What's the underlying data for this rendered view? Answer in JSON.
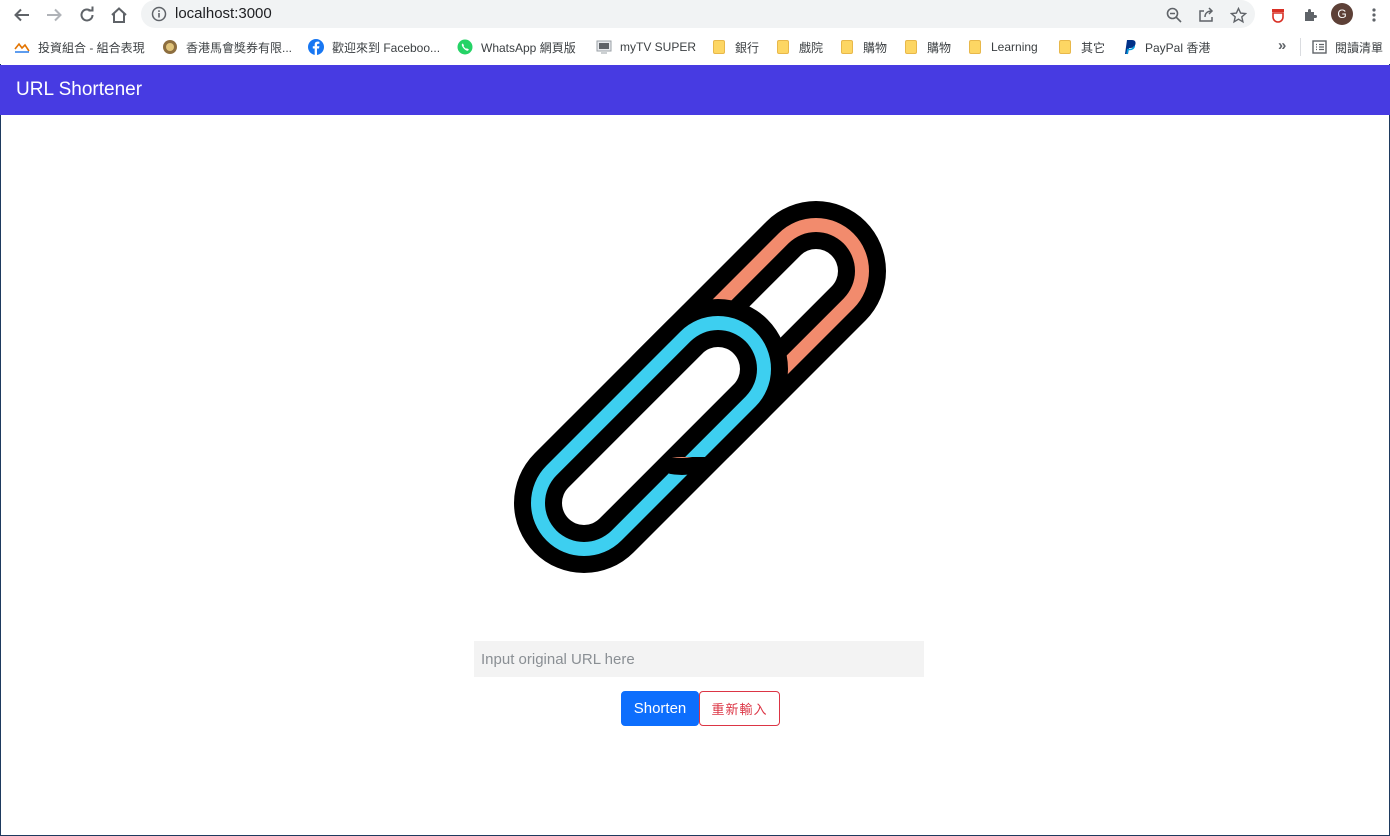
{
  "browser": {
    "url": "localhost:3000",
    "avatar_initial": "G",
    "reading_list_label": "閱讀清單",
    "more_bookmarks": "»"
  },
  "bookmarks": [
    {
      "label": "投資組合 - 組合表現",
      "icon": "portfolio-icon"
    },
    {
      "label": "香港馬會獎券有限...",
      "icon": "hkjc-icon"
    },
    {
      "label": "歡迎來到 Faceboo...",
      "icon": "facebook-icon"
    },
    {
      "label": "WhatsApp 網頁版",
      "icon": "whatsapp-icon"
    },
    {
      "label": "myTV SUPER",
      "icon": "mytv-icon"
    },
    {
      "label": "銀行",
      "icon": "folder-icon"
    },
    {
      "label": "戲院",
      "icon": "folder-icon"
    },
    {
      "label": "購物",
      "icon": "folder-icon"
    },
    {
      "label": "購物",
      "icon": "folder-icon"
    },
    {
      "label": "Learning",
      "icon": "folder-icon"
    },
    {
      "label": "其它",
      "icon": "folder-icon"
    },
    {
      "label": "PayPal 香港",
      "icon": "paypal-icon"
    }
  ],
  "app": {
    "brand": "URL Shortener",
    "logo_icon": "chain-link-icon",
    "input_placeholder": "Input original URL here",
    "input_value": "",
    "shorten_label": "Shorten",
    "reset_label": "重新輸入"
  },
  "colors": {
    "navbar": "#473be2",
    "link_orange": "#f28b6d",
    "link_blue": "#3dcff0",
    "primary": "#0d6efd",
    "danger": "#dc3545"
  }
}
